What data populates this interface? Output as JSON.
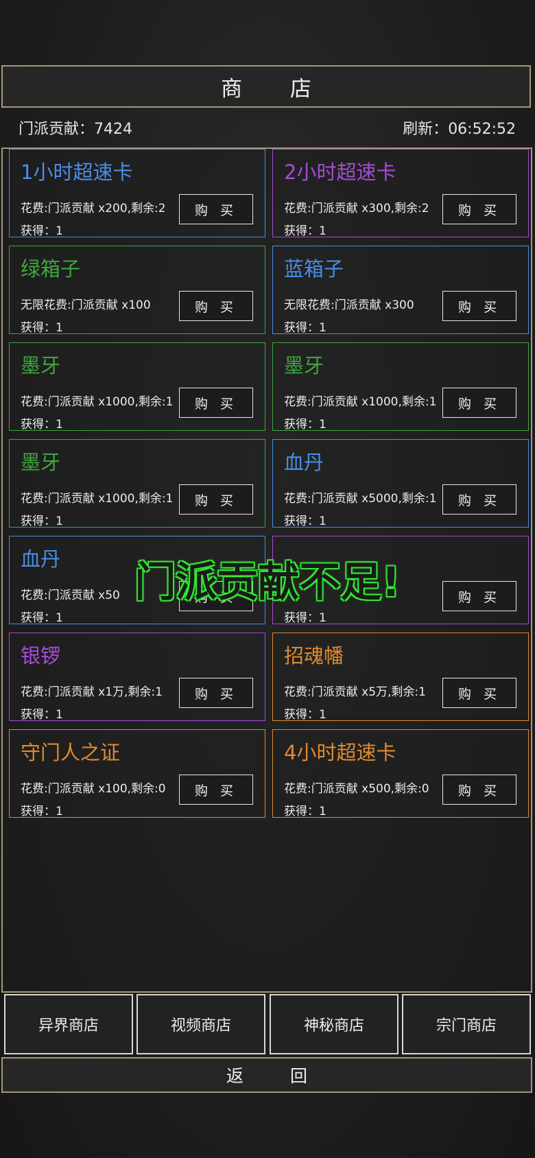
{
  "header": {
    "title": "商 店"
  },
  "status": {
    "contribution_label": "门派贡献：",
    "contribution_value": "7424",
    "refresh_label": "刷新：",
    "refresh_value": "06:52:52"
  },
  "items": [
    {
      "name": "1小时超速卡",
      "cost": "花费:门派贡献 x200,剩余:2",
      "gain": "获得：1",
      "buy": "购 买",
      "color": "#4a8ee8"
    },
    {
      "name": "2小时超速卡",
      "cost": "花费:门派贡献 x300,剩余:2",
      "gain": "获得：1",
      "buy": "购 买",
      "color": "#a64cd6"
    },
    {
      "name": "绿箱子",
      "cost": "无限花费:门派贡献 x100",
      "gain": "获得：1",
      "buy": "购 买",
      "color": "#3fa63f"
    },
    {
      "name": "蓝箱子",
      "cost": "无限花费:门派贡献 x300",
      "gain": "获得：1",
      "buy": "购 买",
      "color": "#4a8ee8"
    },
    {
      "name": "墨牙",
      "cost": "花费:门派贡献 x1000,剩余:1",
      "gain": "获得：1",
      "buy": "购 买",
      "color": "#3fa63f"
    },
    {
      "name": "墨牙",
      "cost": "花费:门派贡献 x1000,剩余:1",
      "gain": "获得：1",
      "buy": "购 买",
      "color": "#3fa63f"
    },
    {
      "name": "墨牙",
      "cost": "花费:门派贡献 x1000,剩余:1",
      "gain": "获得：1",
      "buy": "购 买",
      "color": "#3fa63f"
    },
    {
      "name": "血丹",
      "cost": "花费:门派贡献 x5000,剩余:1",
      "gain": "获得：1",
      "buy": "购 买",
      "color": "#4a8ee8"
    },
    {
      "name": "血丹",
      "cost": "花费:门派贡献 x50",
      "gain": "获得：1",
      "buy": "购 买",
      "color": "#4a8ee8"
    },
    {
      "name": "",
      "cost": "",
      "gain": "获得：1",
      "buy": "购 买",
      "color": "#a64cd6"
    },
    {
      "name": "银锣",
      "cost": "花费:门派贡献 x1万,剩余:1",
      "gain": "获得：1",
      "buy": "购 买",
      "color": "#a64cd6"
    },
    {
      "name": "招魂幡",
      "cost": "花费:门派贡献 x5万,剩余:1",
      "gain": "获得：1",
      "buy": "购 买",
      "color": "#e08a2e"
    },
    {
      "name": "守门人之证",
      "cost": "花费:门派贡献 x100,剩余:0",
      "gain": "获得：1",
      "buy": "购 买",
      "color": "#e08a2e"
    },
    {
      "name": "4小时超速卡",
      "cost": "花费:门派贡献 x500,剩余:0",
      "gain": "获得：1",
      "buy": "购 买",
      "color": "#e08a2e"
    }
  ],
  "tabs": [
    "异界商店",
    "视频商店",
    "神秘商店",
    "宗门商店"
  ],
  "back": "返 回",
  "toast": "门派贡献不足!"
}
